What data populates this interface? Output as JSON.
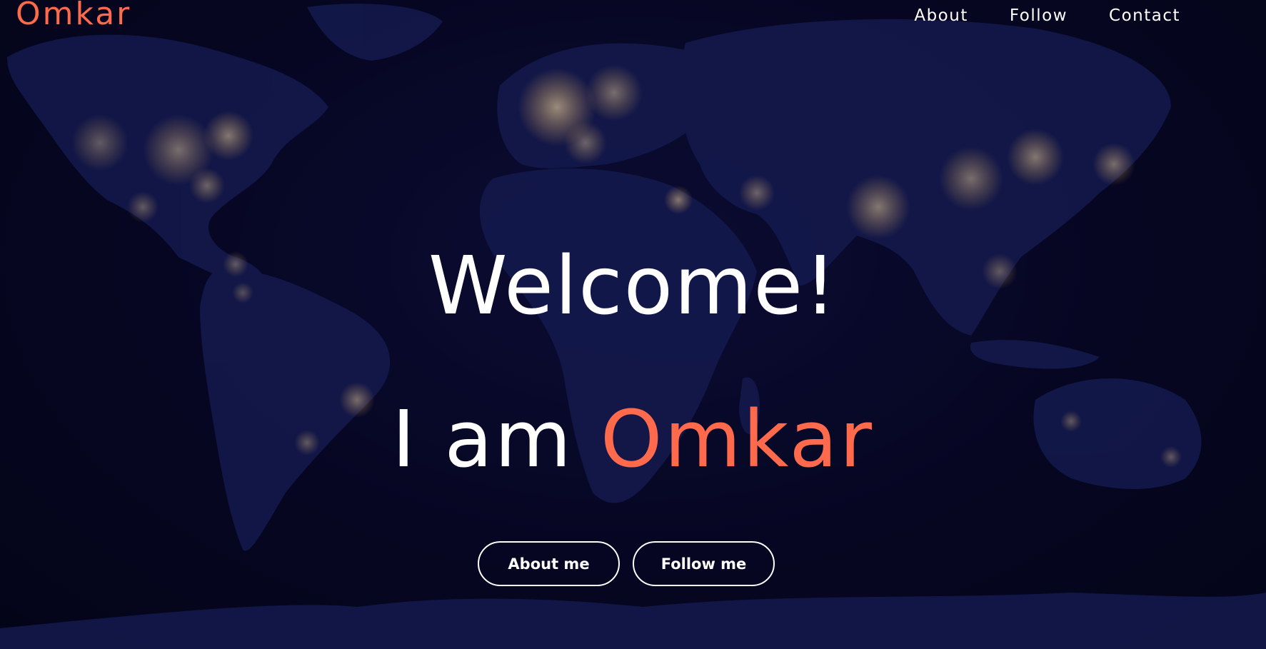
{
  "nav": {
    "logo": "Omkar",
    "links": [
      {
        "label": "About"
      },
      {
        "label": "Follow"
      },
      {
        "label": "Contact"
      }
    ]
  },
  "hero": {
    "welcome": "Welcome!",
    "intro_prefix": "I am ",
    "intro_name": "Omkar"
  },
  "buttons": {
    "about": "About me",
    "follow": "Follow me"
  },
  "colors": {
    "accent": "#ff6a4d",
    "background": "#060622",
    "land": "#141a4e",
    "city_lights": "#ffd27a"
  }
}
